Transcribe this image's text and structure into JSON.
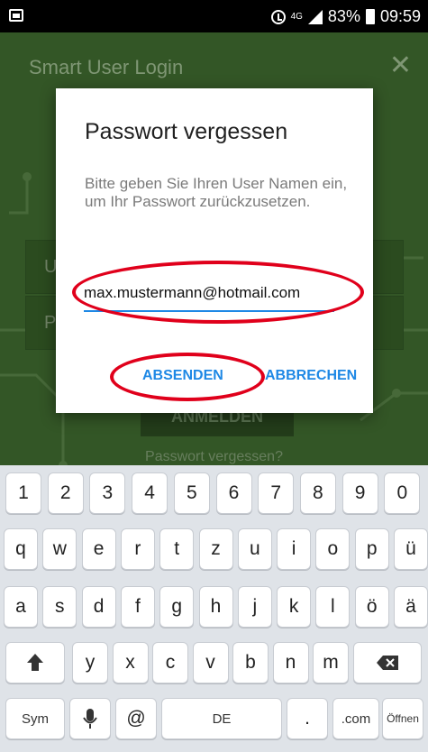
{
  "status_bar": {
    "network": "4G",
    "battery_percent": "83%",
    "time": "09:59"
  },
  "app": {
    "title": "Smart User Login",
    "username_placeholder": "U",
    "password_placeholder": "P",
    "login_button": "ANMELDEN",
    "forgot_link": "Passwort vergessen?"
  },
  "dialog": {
    "title": "Passwort vergessen",
    "message": "Bitte geben Sie Ihren User Namen ein, um Ihr Passwort zurückzusetzen.",
    "email_value": "max.mustermann@hotmail.com",
    "send_label": "ABSENDEN",
    "cancel_label": "ABBRECHEN"
  },
  "annotation_color": "#e0001b",
  "keyboard": {
    "row_numbers": [
      "1",
      "2",
      "3",
      "4",
      "5",
      "6",
      "7",
      "8",
      "9",
      "0"
    ],
    "row_1": [
      "q",
      "w",
      "e",
      "r",
      "t",
      "z",
      "u",
      "i",
      "o",
      "p",
      "ü"
    ],
    "row_2": [
      "a",
      "s",
      "d",
      "f",
      "g",
      "h",
      "j",
      "k",
      "l",
      "ö",
      "ä"
    ],
    "row_3": [
      "y",
      "x",
      "c",
      "v",
      "b",
      "n",
      "m"
    ],
    "sym_label": "Sym",
    "at_label": "@",
    "space_label": "DE",
    "period_label": ".",
    "com_label": ".com",
    "enter_label": "Öffnen"
  }
}
